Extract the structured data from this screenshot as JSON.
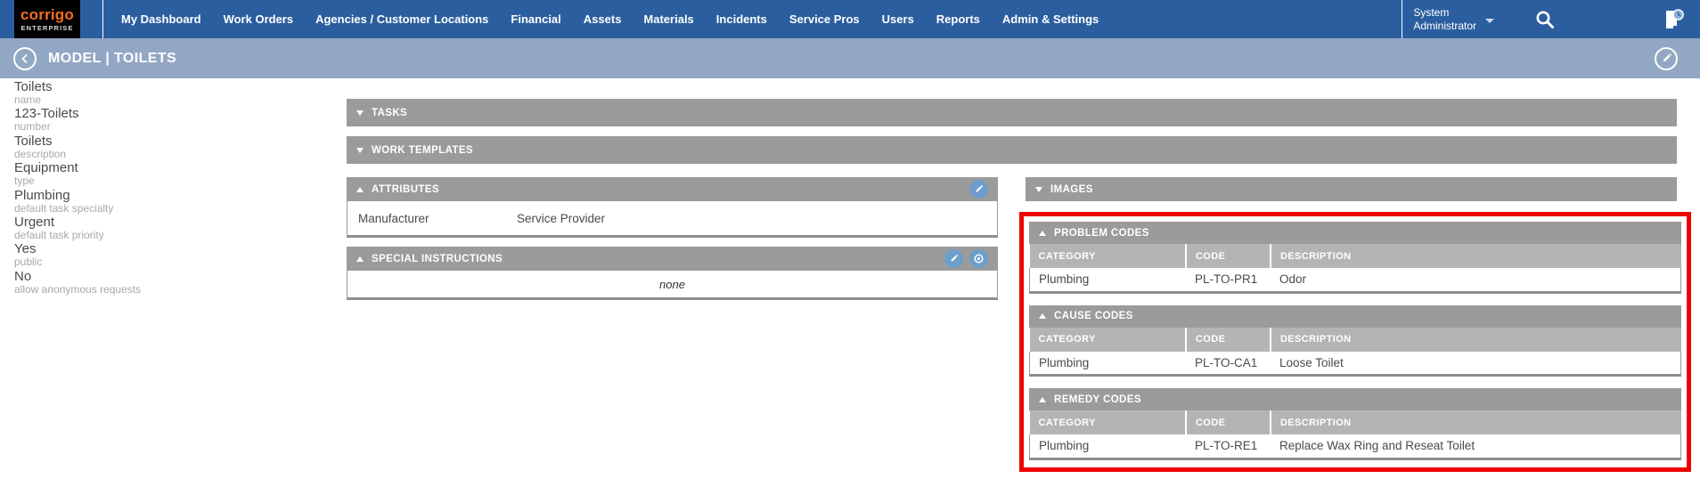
{
  "brand": {
    "name": "corrigo",
    "sub": "ENTERPRISE"
  },
  "nav": {
    "items": [
      "My Dashboard",
      "Work Orders",
      "Agencies / Customer Locations",
      "Financial",
      "Assets",
      "Materials",
      "Incidents",
      "Service Pros",
      "Users",
      "Reports",
      "Admin & Settings"
    ],
    "user": {
      "line1": "System",
      "line2": "Administrator"
    }
  },
  "title_bar": {
    "title": "MODEL | TOILETS"
  },
  "sidebar": {
    "fields": [
      {
        "value": "Toilets",
        "label": "name"
      },
      {
        "value": "123-Toilets",
        "label": "number"
      },
      {
        "value": "Toilets",
        "label": "description"
      },
      {
        "value": "Equipment",
        "label": "type"
      },
      {
        "value": "Plumbing",
        "label": "default task specialty"
      },
      {
        "value": "Urgent",
        "label": "default task priority"
      },
      {
        "value": "Yes",
        "label": "public"
      },
      {
        "value": "No",
        "label": "allow anonymous requests"
      }
    ]
  },
  "panels": {
    "tasks": {
      "title": "TASKS"
    },
    "work_templates": {
      "title": "WORK TEMPLATES"
    },
    "attributes": {
      "title": "ATTRIBUTES",
      "rows": [
        {
          "name": "Manufacturer",
          "value": "Service Provider"
        }
      ]
    },
    "special_instructions": {
      "title": "SPECIAL INSTRUCTIONS",
      "content": "none"
    },
    "images": {
      "title": "IMAGES"
    },
    "problem_codes": {
      "title": "PROBLEM CODES",
      "headers": [
        "CATEGORY",
        "CODE",
        "DESCRIPTION"
      ],
      "rows": [
        [
          "Plumbing",
          "PL-TO-PR1",
          "Odor"
        ]
      ]
    },
    "cause_codes": {
      "title": "CAUSE CODES",
      "headers": [
        "CATEGORY",
        "CODE",
        "DESCRIPTION"
      ],
      "rows": [
        [
          "Plumbing",
          "PL-TO-CA1",
          "Loose Toilet"
        ]
      ]
    },
    "remedy_codes": {
      "title": "REMEDY CODES",
      "headers": [
        "CATEGORY",
        "CODE",
        "DESCRIPTION"
      ],
      "rows": [
        [
          "Plumbing",
          "PL-TO-RE1",
          "Replace Wax Ring and Reseat Toilet"
        ]
      ]
    }
  },
  "colors": {
    "nav_blue": "#2b5e9f",
    "logo_orange": "#f36f21",
    "title_bar_blue": "#92a7c3",
    "panel_header_gray": "#9b9b9b",
    "table_header_gray": "#b4b4b4",
    "icon_circle_blue": "#6d9ecb",
    "annotation_red": "#ee0000"
  }
}
